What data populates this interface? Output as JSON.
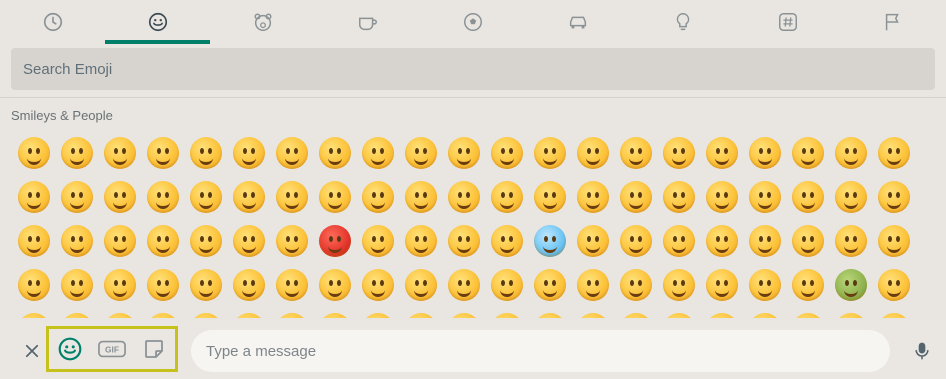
{
  "categories": [
    {
      "icon": "clock-icon"
    },
    {
      "icon": "smiley-icon",
      "active": true
    },
    {
      "icon": "bear-icon"
    },
    {
      "icon": "cup-icon"
    },
    {
      "icon": "ball-icon"
    },
    {
      "icon": "car-icon"
    },
    {
      "icon": "bulb-icon"
    },
    {
      "icon": "hash-icon"
    },
    {
      "icon": "flag-icon"
    }
  ],
  "search": {
    "placeholder": "Search Emoji"
  },
  "section": {
    "title": "Smileys & People"
  },
  "emoji_rows": 5,
  "emoji_cols": 21,
  "composer": {
    "placeholder": "Type a message",
    "gif_label": "GIF"
  },
  "colors": {
    "accent": "#00806a",
    "highlight": "#c6c21b"
  }
}
